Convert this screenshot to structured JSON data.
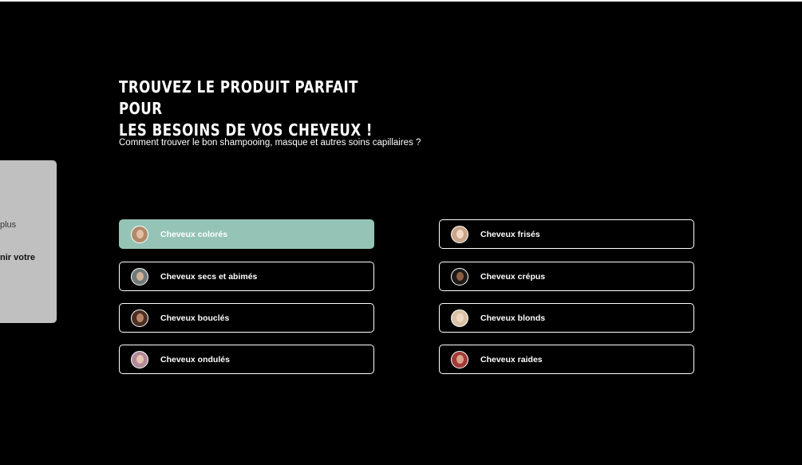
{
  "header": {
    "title_line1": "TROUVEZ LE PRODUIT PARFAIT POUR",
    "title_line2": "LES BESOINS DE VOS CHEVEUX !",
    "subtitle": "Comment trouver le bon shampooing, masque et autres soins capillaires ?"
  },
  "side_card": {
    "line1": "plus",
    "line2": "nir votre"
  },
  "hair_types": [
    {
      "label": "Cheveux colorés",
      "active": true,
      "avatar_icon": "woman-portrait-icon"
    },
    {
      "label": "Cheveux secs et abimés",
      "active": false,
      "avatar_icon": "woman-portrait-icon"
    },
    {
      "label": "Cheveux bouclés",
      "active": false,
      "avatar_icon": "woman-portrait-icon"
    },
    {
      "label": "Cheveux ondulés",
      "active": false,
      "avatar_icon": "woman-portrait-icon"
    },
    {
      "label": "Cheveux frisés",
      "active": false,
      "avatar_icon": "woman-portrait-icon"
    },
    {
      "label": "Cheveux crépus",
      "active": false,
      "avatar_icon": "woman-portrait-icon"
    },
    {
      "label": "Cheveux blonds",
      "active": false,
      "avatar_icon": "woman-portrait-icon"
    },
    {
      "label": "Cheveux raides",
      "active": false,
      "avatar_icon": "woman-portrait-icon"
    }
  ],
  "colors": {
    "background": "#000000",
    "active_button": "#95c4b7",
    "button_border": "#ffffff",
    "side_card": "#c0c0c0"
  }
}
